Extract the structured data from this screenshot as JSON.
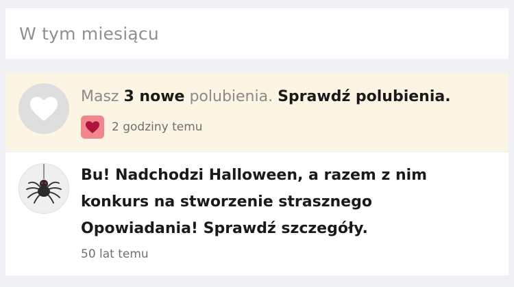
{
  "section": {
    "title": "W tym miesiącu"
  },
  "notifications": [
    {
      "type": "likes",
      "prefix": "Masz ",
      "count": "3 nowe",
      "middle": " polubienia. ",
      "link": "Sprawdź polubienia.",
      "time": "2 godziny temu",
      "avatar_icon": "heart-icon",
      "badge_icon": "heart-icon",
      "colors": {
        "background": "#fcf5e3",
        "badge": "#f2868d",
        "heart": "#b0123e"
      }
    },
    {
      "type": "announcement",
      "lines": [
        "Bu! Nadchodzi Halloween, a razem z nim",
        "konkurs na stworzenie strasznego",
        "Opowiadania! Sprawdź szczegóły."
      ],
      "time": "50 lat temu",
      "avatar_icon": "spider-icon"
    }
  ]
}
